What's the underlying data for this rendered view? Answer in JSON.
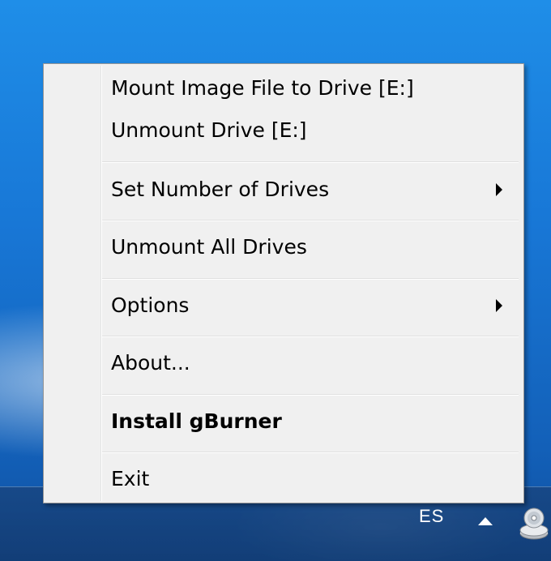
{
  "menu": {
    "items": [
      {
        "label": "Mount Image File to Drive [E:]"
      },
      {
        "label": "Unmount Drive [E:]"
      },
      {
        "label": "Set Number of Drives",
        "submenu": true
      },
      {
        "label": "Unmount All Drives"
      },
      {
        "label": "Options",
        "submenu": true
      },
      {
        "label": "About..."
      },
      {
        "label": "Install gBurner",
        "bold": true
      },
      {
        "label": "Exit"
      }
    ]
  },
  "taskbar": {
    "language": "ES",
    "tray_icons": [
      "show-hidden-icons-arrow-icon",
      "virtual-drive-icon"
    ]
  },
  "colors": {
    "desktop_blue": "#1877d6",
    "menu_background": "#f0f0f0",
    "menu_border": "#979797"
  }
}
